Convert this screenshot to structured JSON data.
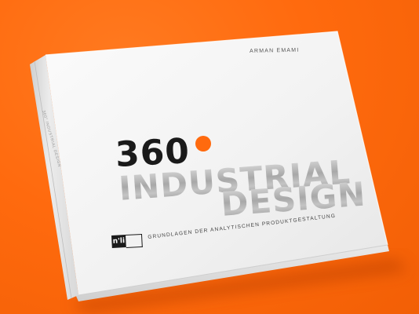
{
  "scene": {
    "background_color": "#ff6a0e",
    "accent_color": "#ff6a0e",
    "book_color": "#f4f4f4"
  },
  "book": {
    "author": "ARMAN EMAMI",
    "title_number": "360",
    "title_line1": "INDUSTRIAL",
    "title_line2": "DESIGN",
    "subtitle": "GRUNDLAGEN DER ANALYTISCHEN PRODUKTGESTALTUNG",
    "publisher_logo": "n'li",
    "spine_text": "360° INDUSTRIAL DESIGN"
  }
}
